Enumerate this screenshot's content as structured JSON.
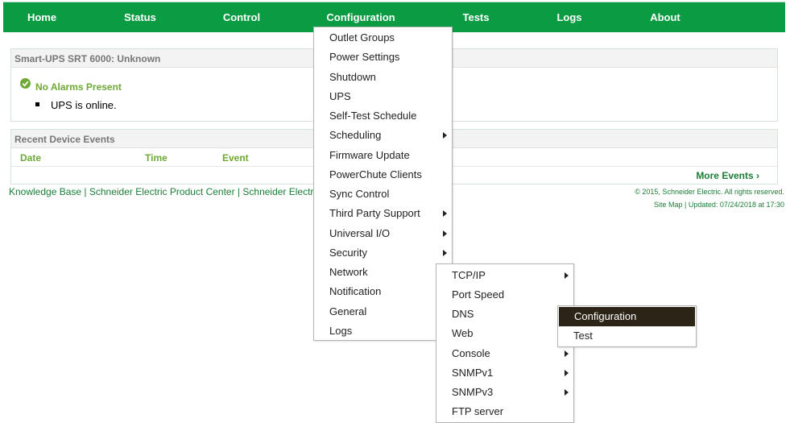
{
  "nav": {
    "home": "Home",
    "status": "Status",
    "control": "Control",
    "configuration": "Configuration",
    "tests": "Tests",
    "logs": "Logs",
    "about": "About"
  },
  "status_panel": {
    "title": "Smart-UPS SRT 6000: Unknown",
    "alarm_text": "No Alarms Present",
    "ups_status": "UPS is online."
  },
  "events_panel": {
    "title": "Recent Device Events",
    "columns": [
      "Date",
      "Time",
      "Event"
    ],
    "more_events": "More Events ›"
  },
  "footer": {
    "links": "Knowledge Base | Schneider Electric Product Center | Schneider Electr",
    "copyright": "© 2015, Schneider Electric. All rights reserved.",
    "site_map": "Site Map | Updated: 07/24/2018 at 17:30"
  },
  "config_menu": {
    "items": [
      "Outlet Groups",
      "Power Settings",
      "Shutdown",
      "UPS",
      "Self-Test Schedule",
      "Scheduling",
      "Firmware Update",
      "PowerChute Clients",
      "Sync Control",
      "Third Party Support",
      "Universal I/O",
      "Security",
      "Network",
      "Notification",
      "General",
      "Logs"
    ]
  },
  "network_menu": {
    "items": [
      "TCP/IP",
      "Port Speed",
      "DNS",
      "Web",
      "Console",
      "SNMPv1",
      "SNMPv3",
      "FTP server"
    ]
  },
  "dns_menu": {
    "items": [
      "Configuration",
      "Test"
    ]
  },
  "colors": {
    "nav_green": "#0b9c43",
    "accent_green": "#6fa834",
    "active_menu_bg": "#2c2417"
  }
}
